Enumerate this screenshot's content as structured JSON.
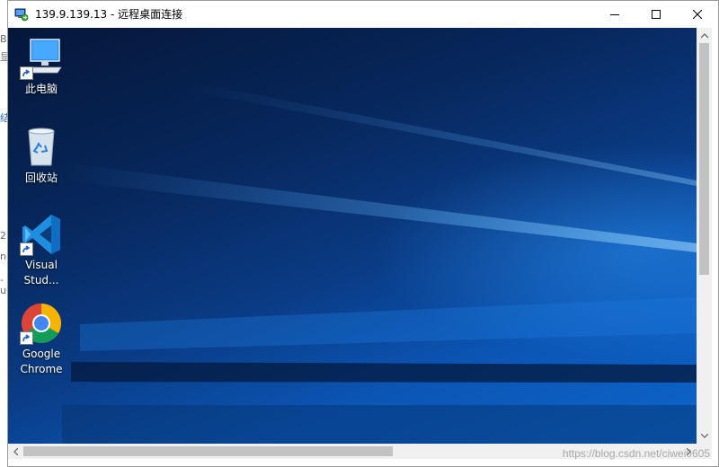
{
  "window": {
    "title": "139.9.139.13 - 远程桌面连接"
  },
  "background_fragments": [
    "B",
    "显",
    "结",
    "2",
    "nF",
    "-u"
  ],
  "desktop_icons": [
    {
      "label": "此电脑",
      "icon": "computer-icon"
    },
    {
      "label": "回收站",
      "icon": "recycle-bin-icon"
    },
    {
      "label": "Visual\nStud...",
      "icon": "vscode-icon"
    },
    {
      "label": "Google\nChrome",
      "icon": "chrome-icon"
    }
  ],
  "watermark": "https://blog.csdn.net/ciwei0605",
  "colors": {
    "desktop_dark": "#05173a",
    "desktop_light": "#0d66cc",
    "scrollbar": "#f0f0f0",
    "thumb": "#c2c2c2"
  }
}
